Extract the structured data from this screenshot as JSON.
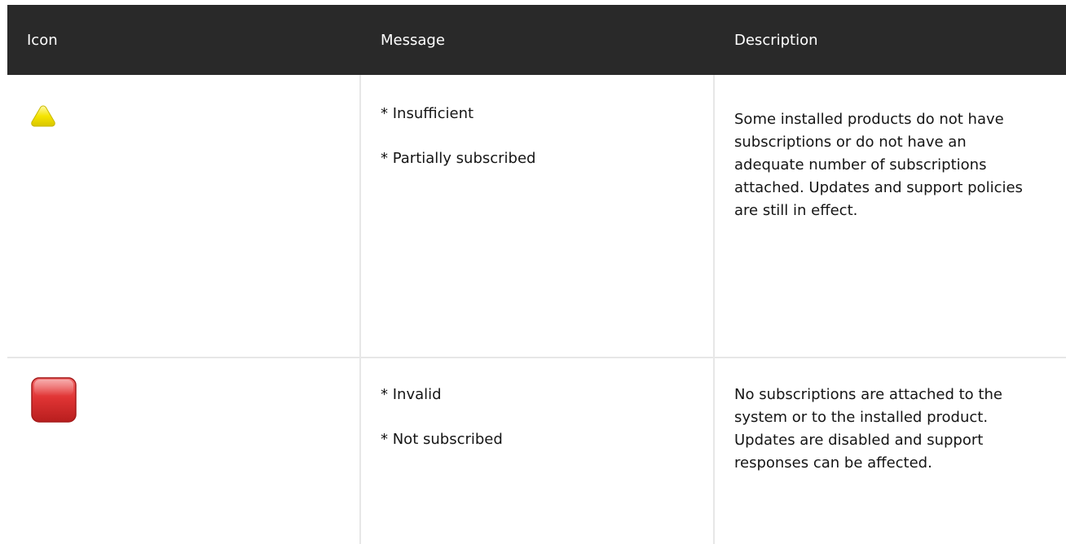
{
  "table": {
    "headers": [
      "Icon",
      "Message",
      "Description"
    ],
    "rows": [
      {
        "icon": "yellow-warning-triangle-icon",
        "messages": [
          "* Insufficient",
          "* Partially subscribed"
        ],
        "description": "Some installed products do not have subscriptions or do not have an adequate number of subscriptions attached. Updates and support policies are still in effect."
      },
      {
        "icon": "red-invalid-square-icon",
        "messages": [
          "* Invalid",
          "* Not subscribed"
        ],
        "description": "No subscriptions are attached to the system or to the installed product. Updates are disabled and support responses can be affected."
      }
    ]
  },
  "colors": {
    "header_bg": "#292929",
    "border": "#e7e7e7",
    "warning": "#f5e400",
    "invalid": "#d62828"
  }
}
